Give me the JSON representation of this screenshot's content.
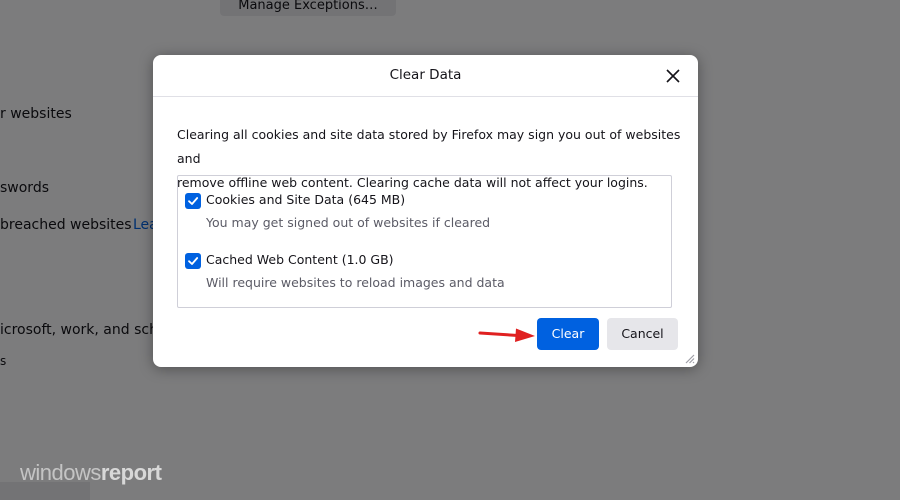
{
  "background": {
    "manage_button": "Manage Exceptions…",
    "texts": [
      "r websites",
      "swords",
      "breached websites",
      "icrosoft, work, and scho",
      "s"
    ],
    "link": "Lea"
  },
  "watermark": {
    "part1": "windows",
    "part2": "report"
  },
  "dialog": {
    "title": "Clear Data",
    "description_line1": "Clearing all cookies and site data stored by Firefox may sign you out of websites and",
    "description_line2": "remove offline web content. Clearing cache data will not affect your logins.",
    "options": [
      {
        "label": "Cookies and Site Data (645 MB)",
        "sub": "You may get signed out of websites if cleared",
        "checked": true
      },
      {
        "label": "Cached Web Content (1.0 GB)",
        "sub": "Will require websites to reload images and data",
        "checked": true
      }
    ],
    "clear_label": "Clear",
    "cancel_label": "Cancel"
  },
  "colors": {
    "accent": "#0061e0",
    "arrow": "#e02020",
    "overlay": "rgba(0,0,0,0.5)"
  },
  "icons": [
    "close-icon",
    "checkmark-icon",
    "resize-grip-icon",
    "red-arrow-icon"
  ]
}
